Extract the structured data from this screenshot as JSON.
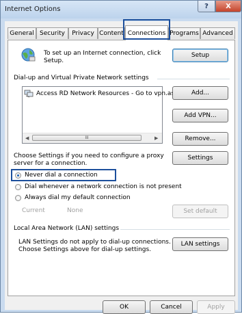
{
  "window": {
    "title": "Internet Options",
    "help_icon": "?",
    "close_icon": "X"
  },
  "tabs": [
    "General",
    "Security",
    "Privacy",
    "Content",
    "Connections",
    "Programs",
    "Advanced"
  ],
  "active_tab": "Connections",
  "setup": {
    "text": "To set up an Internet connection, click Setup.",
    "line1": "To set up an Internet connection, click",
    "line2": "Setup.",
    "button": "Setup",
    "icon": "globe-network-icon"
  },
  "dialup": {
    "group_label": "Dial-up and Virtual Private Network settings",
    "entries": [
      "Access RD Network Resources - Go to vpn.as"
    ],
    "entry_icon": "network-connection-icon",
    "scroll_grip": "III",
    "add_button": "Add...",
    "add_vpn_button": "Add VPN...",
    "remove_button": "Remove...",
    "proxy_text_line1": "Choose Settings if you need to configure a proxy",
    "proxy_text_line2": "server for a connection.",
    "settings_button": "Settings"
  },
  "radios": [
    {
      "label": "Never dial a connection",
      "checked": true
    },
    {
      "label": "Dial whenever a network connection is not present",
      "checked": false
    },
    {
      "label": "Always dial my default connection",
      "checked": false
    }
  ],
  "current": {
    "label": "Current",
    "value": "None",
    "set_default_button": "Set default"
  },
  "lan": {
    "group_label": "Local Area Network (LAN) settings",
    "text_line1": "LAN Settings do not apply to dial-up connections.",
    "text_line2": "Choose Settings above for dial-up settings.",
    "button": "LAN settings"
  },
  "footer": {
    "ok": "OK",
    "cancel": "Cancel",
    "apply": "Apply"
  },
  "colors": {
    "highlight": "#1c4f9c",
    "window_frame": "#c9dbef",
    "close_button": "#c5432b"
  }
}
